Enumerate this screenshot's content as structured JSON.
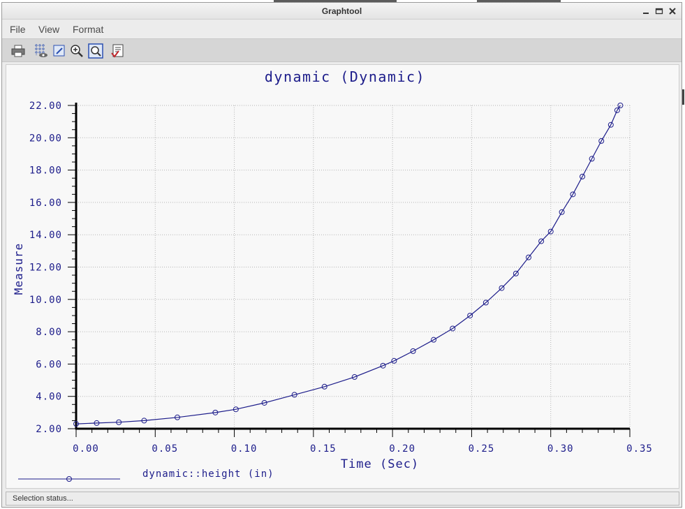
{
  "window": {
    "title": "Graphtool"
  },
  "menubar": {
    "file": "File",
    "view": "View",
    "format": "Format"
  },
  "toolbar": {
    "icons": [
      "print-icon",
      "grid-icon",
      "edit-icon",
      "zoom-in-icon",
      "zoom-fit-icon",
      "export-icon"
    ]
  },
  "status": {
    "text": "Selection status..."
  },
  "chart_data": {
    "type": "line",
    "title": "dynamic (Dynamic)",
    "xlabel": "Time (Sec)",
    "ylabel": "Measure",
    "xlim": [
      0,
      0.35
    ],
    "ylim": [
      2,
      22
    ],
    "x_ticks": [
      "0.00",
      "0.05",
      "0.10",
      "0.15",
      "0.20",
      "0.25",
      "0.30",
      "0.35"
    ],
    "y_ticks": [
      "2.00",
      "4.00",
      "6.00",
      "8.00",
      "10.00",
      "12.00",
      "14.00",
      "16.00",
      "18.00",
      "20.00",
      "22.00"
    ],
    "grid": true,
    "legend_position": "bottom-left",
    "colors": {
      "series": "#1c1c8a",
      "axis": "#000000",
      "grid": "#b5b5b5"
    },
    "series": [
      {
        "name": "dynamic::height (in)",
        "marker": "circle",
        "x": [
          0.0,
          0.013,
          0.027,
          0.043,
          0.064,
          0.088,
          0.101,
          0.119,
          0.138,
          0.157,
          0.176,
          0.194,
          0.201,
          0.213,
          0.226,
          0.238,
          0.249,
          0.259,
          0.269,
          0.278,
          0.286,
          0.294,
          0.3,
          0.307,
          0.314,
          0.32,
          0.326,
          0.332,
          0.338,
          0.342,
          0.344
        ],
        "y": [
          2.3,
          2.35,
          2.4,
          2.5,
          2.7,
          3.0,
          3.2,
          3.6,
          4.1,
          4.6,
          5.2,
          5.9,
          6.2,
          6.8,
          7.5,
          8.2,
          9.0,
          9.8,
          10.7,
          11.6,
          12.6,
          13.6,
          14.2,
          15.4,
          16.5,
          17.6,
          18.7,
          19.8,
          20.8,
          21.7,
          22.0
        ]
      }
    ]
  }
}
